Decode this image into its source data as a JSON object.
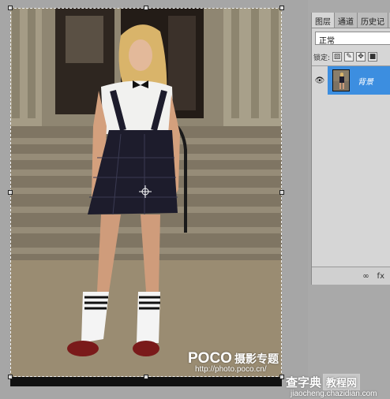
{
  "canvas": {
    "photo_subject": "photo-background-layer"
  },
  "watermark": {
    "logo": "POCO",
    "logo_suffix": "摄影专题",
    "url": "http://photo.poco.cn/"
  },
  "layers_panel": {
    "tabs": [
      "图层",
      "通道",
      "历史记"
    ],
    "blend_mode": "正常",
    "lock_label": "锁定:",
    "layers": [
      {
        "name": "背景",
        "selected": true
      }
    ],
    "footer_icons": [
      "link-icon",
      "fx-icon"
    ],
    "fx_label": "fx"
  },
  "site_watermark": {
    "title": "查字典",
    "badge": "教程网",
    "url": "jiaocheng.chazidian.com"
  },
  "colors": {
    "selected_layer": "#3c8ee0",
    "panel_bg": "#d6d6d6",
    "workspace_bg": "#a6a6a6"
  }
}
